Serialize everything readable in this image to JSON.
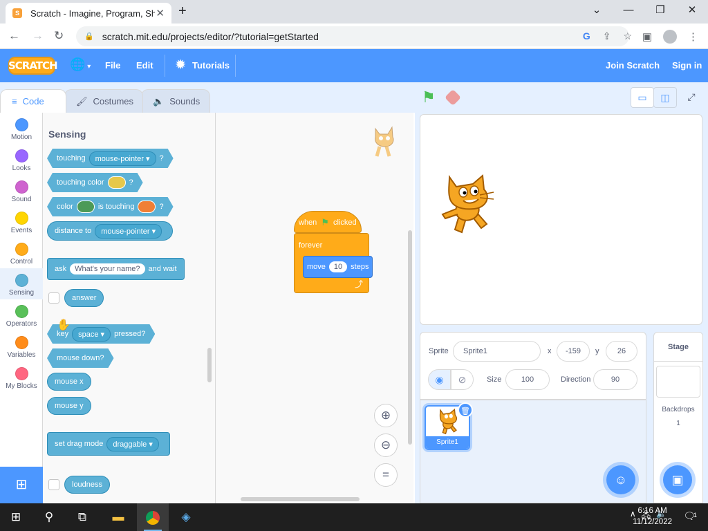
{
  "browser": {
    "tab_title": "Scratch - Imagine, Program, Share",
    "url": "scratch.mit.edu/projects/editor/?tutorial=getStarted"
  },
  "menubar": {
    "logo": "SCRATCH",
    "file": "File",
    "edit": "Edit",
    "tutorials": "Tutorials",
    "join": "Join Scratch",
    "signin": "Sign in"
  },
  "editor_tabs": {
    "code": "Code",
    "costumes": "Costumes",
    "sounds": "Sounds"
  },
  "categories": [
    {
      "label": "Motion",
      "color": "#4c97ff"
    },
    {
      "label": "Looks",
      "color": "#9966ff"
    },
    {
      "label": "Sound",
      "color": "#cf63cf"
    },
    {
      "label": "Events",
      "color": "#ffd500"
    },
    {
      "label": "Control",
      "color": "#ffab19"
    },
    {
      "label": "Sensing",
      "color": "#5cb1d6"
    },
    {
      "label": "Operators",
      "color": "#59c059"
    },
    {
      "label": "Variables",
      "color": "#ff8c1a"
    },
    {
      "label": "My Blocks",
      "color": "#ff6680"
    }
  ],
  "palette": {
    "title": "Sensing",
    "touching": {
      "text": "touching",
      "menu": "mouse-pointer",
      "q": "?"
    },
    "touching_color": {
      "text": "touching color",
      "q": "?",
      "swatch": "#e6c84a"
    },
    "color_touching": {
      "t1": "color",
      "t2": "is touching",
      "q": "?",
      "swatch1": "#4c9a57",
      "swatch2": "#f07f36"
    },
    "distance": {
      "text": "distance to",
      "menu": "mouse-pointer"
    },
    "ask": {
      "text": "ask",
      "field": "What's your name?",
      "tail": "and wait"
    },
    "answer": "answer",
    "key_pressed": {
      "text": "key",
      "menu": "space",
      "tail": "pressed?"
    },
    "mouse_down": "mouse down?",
    "mouse_x": "mouse x",
    "mouse_y": "mouse y",
    "drag_mode": {
      "text": "set drag mode",
      "menu": "draggable"
    },
    "loudness": "loudness"
  },
  "script": {
    "when": "when",
    "clicked": "clicked",
    "forever": "forever",
    "move": "move",
    "steps_value": "10",
    "steps": "steps"
  },
  "sprite_info": {
    "sprite_label": "Sprite",
    "sprite_name": "Sprite1",
    "x_label": "x",
    "x_value": "-159",
    "y_label": "y",
    "y_value": "26",
    "show_label": "Show",
    "size_label": "Size",
    "size_value": "100",
    "direction_label": "Direction",
    "direction_value": "90"
  },
  "sprites": [
    {
      "name": "Sprite1"
    }
  ],
  "stage_panel": {
    "title": "Stage",
    "backdrops_label": "Backdrops",
    "backdrops_count": "1"
  },
  "taskbar": {
    "time": "6:16 AM",
    "date": "11/12/2022",
    "notifications": "1"
  },
  "colors": {
    "scratch_blue": "#4c97ff",
    "sensing": "#5cb1d6",
    "control": "#ffab19",
    "motion": "#4c97ff",
    "cat_orange": "#f5a623"
  }
}
